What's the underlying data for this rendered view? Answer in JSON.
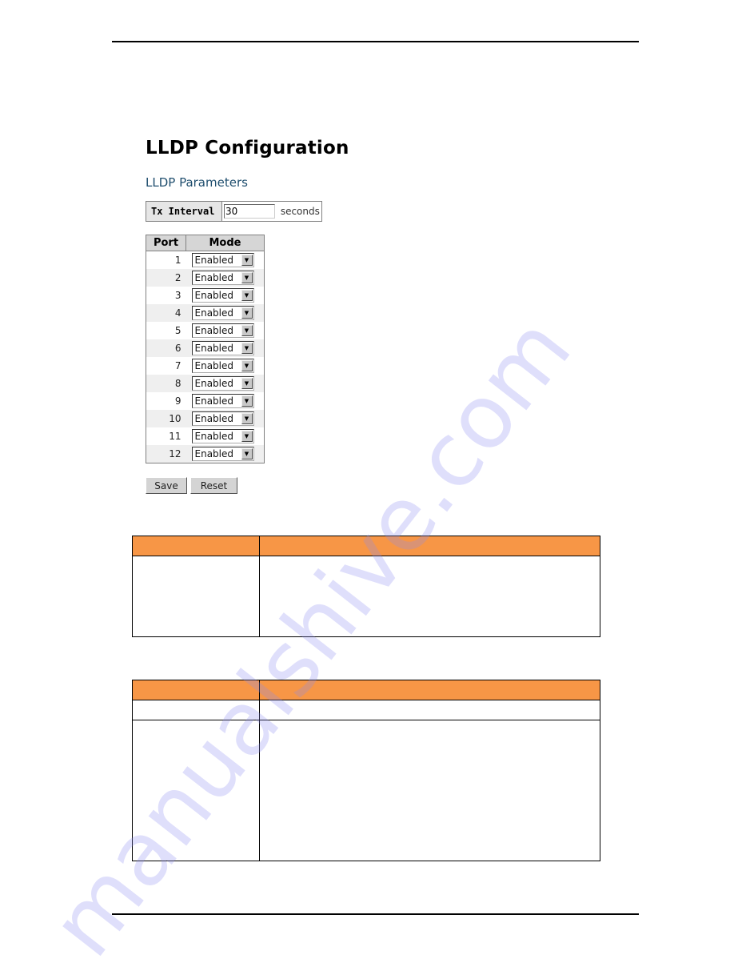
{
  "page": {
    "title": "LLDP Configuration",
    "section_title": "LLDP Parameters"
  },
  "tx_interval": {
    "label": "Tx Interval",
    "value": "30",
    "unit": "seconds"
  },
  "port_table": {
    "headers": [
      "Port",
      "Mode"
    ],
    "rows": [
      {
        "port": "1",
        "mode": "Enabled"
      },
      {
        "port": "2",
        "mode": "Enabled"
      },
      {
        "port": "3",
        "mode": "Enabled"
      },
      {
        "port": "4",
        "mode": "Enabled"
      },
      {
        "port": "5",
        "mode": "Enabled"
      },
      {
        "port": "6",
        "mode": "Enabled"
      },
      {
        "port": "7",
        "mode": "Enabled"
      },
      {
        "port": "8",
        "mode": "Enabled"
      },
      {
        "port": "9",
        "mode": "Enabled"
      },
      {
        "port": "10",
        "mode": "Enabled"
      },
      {
        "port": "11",
        "mode": "Enabled"
      },
      {
        "port": "12",
        "mode": "Enabled"
      }
    ]
  },
  "buttons": {
    "save": "Save",
    "reset": "Reset"
  },
  "description_tables": [
    {
      "header": [
        "",
        ""
      ],
      "rows": [
        [
          "",
          ""
        ]
      ]
    },
    {
      "header": [
        "",
        ""
      ],
      "rows": [
        [
          "",
          ""
        ],
        [
          "",
          ""
        ]
      ]
    }
  ],
  "watermark": "manualshive.com",
  "colors": {
    "table_header_orange": "#f79646",
    "section_title_blue": "#1f4e6e"
  }
}
